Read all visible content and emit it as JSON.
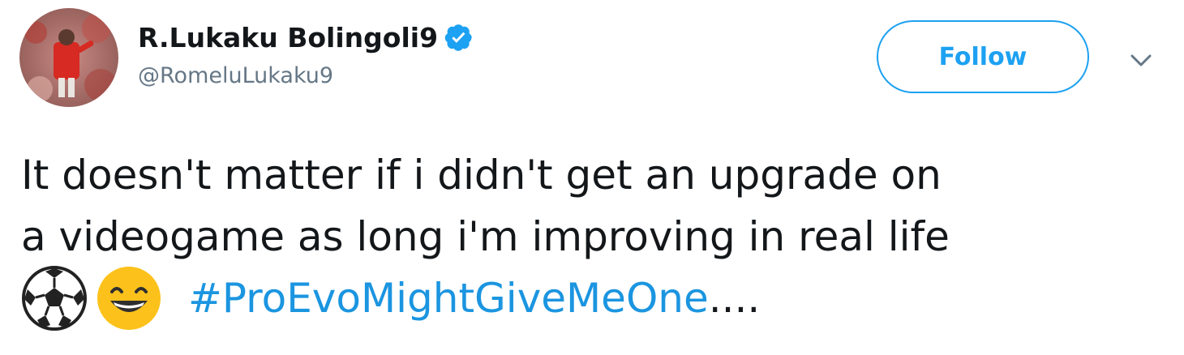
{
  "tweet": {
    "display_name": "R.Lukaku Bolingoli9",
    "handle": "@RomeluLukaku9",
    "follow_label": "Follow",
    "text_line_1": "It doesn't matter if i didn't get  an upgrade on",
    "text_line_2": "a videogame as long i'm improving in real life",
    "hashtag": "#ProEvoMightGiveMeOne",
    "trailing": "....",
    "emojis": [
      "soccer-ball-icon",
      "grinning-face-icon"
    ]
  },
  "colors": {
    "accent": "#1da1f2",
    "hashtag": "#1b95e0",
    "text": "#14171a",
    "muted": "#657786",
    "verified": "#1da1f2"
  }
}
